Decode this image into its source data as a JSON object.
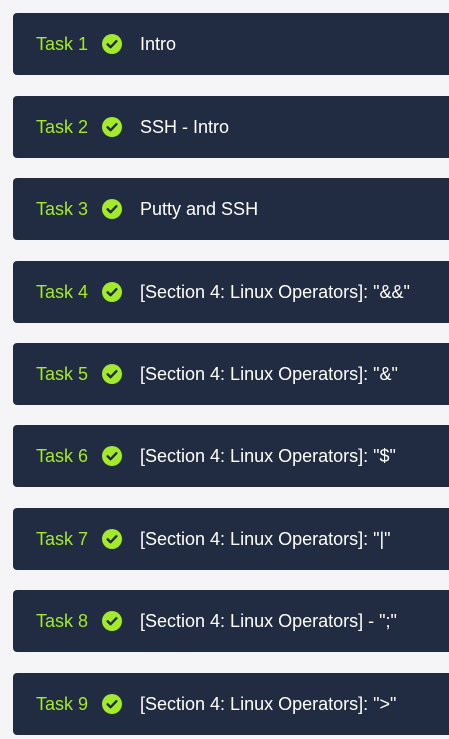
{
  "colors": {
    "page_bg": "#f5f5f7",
    "card_bg": "#212c42",
    "accent": "#a3ea2a",
    "title_text": "#ffffff"
  },
  "tasks": [
    {
      "number": "Task 1",
      "title": "Intro",
      "status_icon": "check-circle-icon"
    },
    {
      "number": "Task 2",
      "title": "SSH - Intro",
      "status_icon": "check-circle-icon"
    },
    {
      "number": "Task 3",
      "title": "Putty and SSH",
      "status_icon": "check-circle-icon"
    },
    {
      "number": "Task 4",
      "title": "[Section 4: Linux Operators]: \"&&\"",
      "status_icon": "check-circle-icon"
    },
    {
      "number": "Task 5",
      "title": "[Section 4: Linux Operators]: \"&\"",
      "status_icon": "check-circle-icon"
    },
    {
      "number": "Task 6",
      "title": "[Section 4: Linux Operators]: \"$\"",
      "status_icon": "check-circle-icon"
    },
    {
      "number": "Task 7",
      "title": "[Section 4: Linux Operators]: \"|\"",
      "status_icon": "check-circle-icon"
    },
    {
      "number": "Task 8",
      "title": "[Section 4: Linux Operators] - \";\"",
      "status_icon": "check-circle-icon"
    },
    {
      "number": "Task 9",
      "title": "[Section 4: Linux Operators]: \">\"",
      "status_icon": "check-circle-icon"
    }
  ]
}
